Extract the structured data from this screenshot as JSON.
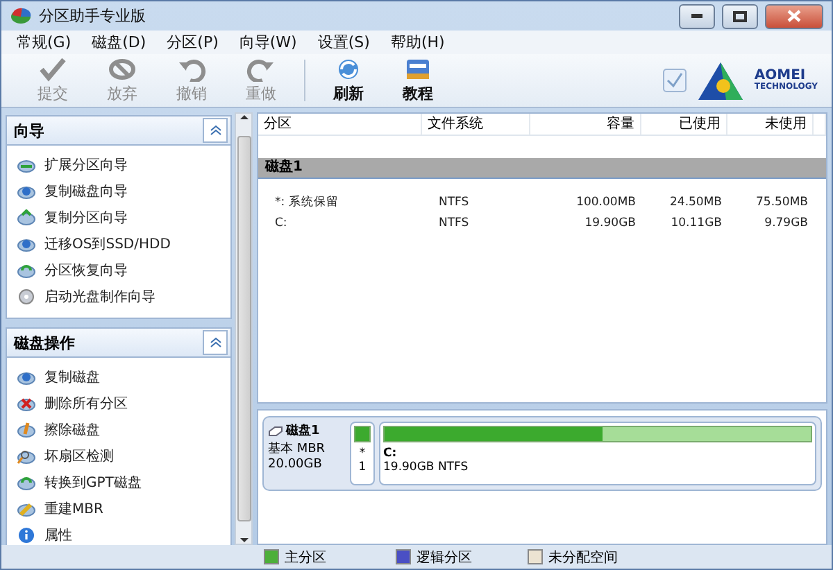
{
  "window": {
    "title": "分区助手专业版"
  },
  "menu": [
    "常规(G)",
    "磁盘(D)",
    "分区(P)",
    "向导(W)",
    "设置(S)",
    "帮助(H)"
  ],
  "toolbar": [
    {
      "label": "提交",
      "kind": "check",
      "disabled": true
    },
    {
      "label": "放弃",
      "kind": "discard",
      "disabled": true
    },
    {
      "label": "撤销",
      "kind": "undo",
      "disabled": true
    },
    {
      "label": "重做",
      "kind": "redo",
      "disabled": true
    },
    {
      "label": "刷新",
      "kind": "refresh",
      "disabled": false
    },
    {
      "label": "教程",
      "kind": "book",
      "disabled": false
    }
  ],
  "logo": {
    "name": "AOMEI",
    "sub": "TECHNOLOGY"
  },
  "sidebar": [
    {
      "title": "向导",
      "expanded": true,
      "items": [
        {
          "label": "扩展分区向导",
          "kind": "extend"
        },
        {
          "label": "复制磁盘向导",
          "kind": "copy"
        },
        {
          "label": "复制分区向导",
          "kind": "copypart"
        },
        {
          "label": "迁移OS到SSD/HDD",
          "kind": "copy"
        },
        {
          "label": "分区恢复向导",
          "kind": "recover"
        },
        {
          "label": "启动光盘制作向导",
          "kind": "cd"
        }
      ]
    },
    {
      "title": "磁盘操作",
      "expanded": true,
      "items": [
        {
          "label": "复制磁盘",
          "kind": "copy"
        },
        {
          "label": "删除所有分区",
          "kind": "delete"
        },
        {
          "label": "擦除磁盘",
          "kind": "wipe"
        },
        {
          "label": "坏扇区检测",
          "kind": "search"
        },
        {
          "label": "转换到GPT磁盘",
          "kind": "recover"
        },
        {
          "label": "重建MBR",
          "kind": "pencil"
        },
        {
          "label": "属性",
          "kind": "info"
        }
      ]
    }
  ],
  "table": {
    "columns": [
      "分区",
      "文件系统",
      "容量",
      "已使用",
      "未使用"
    ],
    "groups": [
      {
        "title": "磁盘1",
        "rows": [
          [
            "*: 系统保留",
            "NTFS",
            "100.00MB",
            "24.50MB",
            "75.50MB"
          ],
          [
            "C:",
            "NTFS",
            "19.90GB",
            "10.11GB",
            "9.79GB"
          ]
        ]
      }
    ]
  },
  "disk_map": {
    "name": "磁盘1",
    "type": "基本 MBR",
    "size": "20.00GB",
    "partitions": [
      {
        "kind": "small",
        "line1": "*",
        "line2": "1",
        "level": 1
      },
      {
        "kind": "large",
        "line1": "C:",
        "line2": "19.90GB NTFS",
        "level": 0.51
      }
    ]
  },
  "legend": [
    {
      "label": "主分区",
      "color": "#4caf3a"
    },
    {
      "label": "逻辑分区",
      "color": "#4a4fc4"
    },
    {
      "label": "未分配空间",
      "color": "#ece3d2"
    }
  ]
}
